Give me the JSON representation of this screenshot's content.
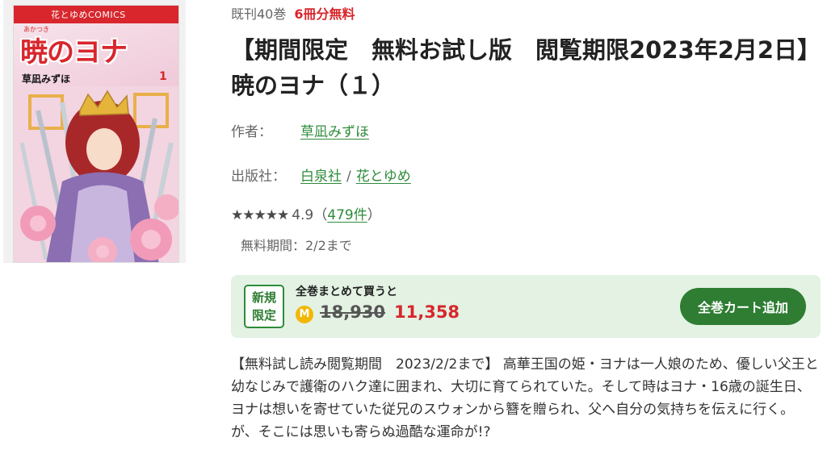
{
  "cover": {
    "imprint": "花とゆめCOMICS",
    "title": "暁のヨナ",
    "title_ruby": "あかつき",
    "author": "草凪みずほ",
    "volume": "1"
  },
  "book": {
    "volume_count": "既刊40巻",
    "free_volumes": "6冊分無料",
    "title": "【期間限定　無料お試し版　閲覧期限2023年2月2日】暁のヨナ（１）",
    "author_label": "作者：",
    "author": "草凪みずほ",
    "publisher_label": "出版社：",
    "publisher": "白泉社",
    "publisher_separator": "/",
    "label": "花とゆめ",
    "stars": "★★★★★",
    "rating": "4.9",
    "review_open": "（",
    "review_count": "479件",
    "review_close": "）",
    "free_period": "無料期間：2/2まで"
  },
  "bundle": {
    "badge_line1": "新規",
    "badge_line2": "限定",
    "label": "全巻まとめて買うと",
    "coin_icon": "M",
    "price_old": "18,930",
    "price_new": "11,358",
    "button": "全巻カート追加"
  },
  "description": "【無料試し読み閲覧期間　2023/2/2まで】 高華王国の姫・ヨナは一人娘のため、優しい父王と幼なじみで護衛のハク達に囲まれ、大切に育てられていた。そして時はヨナ・16歳の誕生日、ヨナは想いを寄せていた従兄のスウォンから簪を贈られ、父へ自分の気持ちを伝えに行く。が、そこには思いも寄らぬ過酷な運命が!?",
  "colors": {
    "accent_red": "#d8262c",
    "link_green": "#2e8b3a",
    "button_green": "#2e7d32",
    "bundle_bg": "#e3f2e3",
    "coin": "#f2b705"
  }
}
